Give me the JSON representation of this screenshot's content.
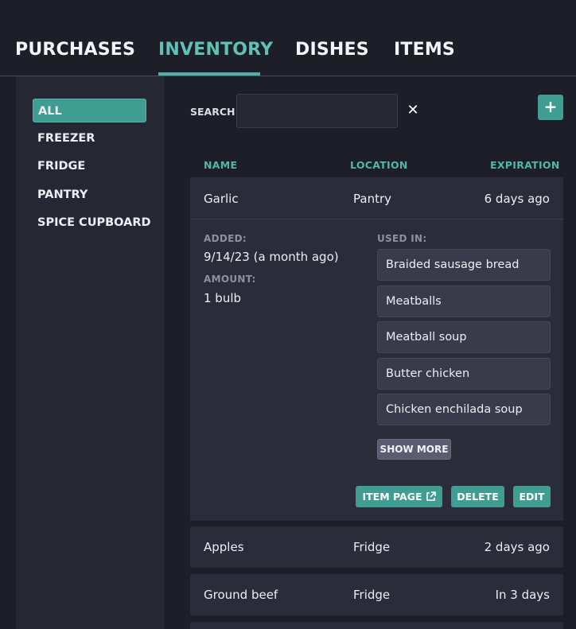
{
  "nav": {
    "tabs": [
      {
        "label": "PURCHASES"
      },
      {
        "label": "INVENTORY"
      },
      {
        "label": "DISHES"
      },
      {
        "label": "ITEMS"
      }
    ],
    "active_tab": "INVENTORY"
  },
  "sidebar": {
    "items": [
      {
        "label": "ALL"
      },
      {
        "label": "FREEZER"
      },
      {
        "label": "FRIDGE"
      },
      {
        "label": "PANTRY"
      },
      {
        "label": "SPICE CUPBOARD"
      }
    ],
    "active": "ALL"
  },
  "search": {
    "label": "SEARCH",
    "value": "",
    "clear_symbol": "✕"
  },
  "add_button": {
    "symbol": "+"
  },
  "table": {
    "headers": {
      "name": "NAME",
      "location": "LOCATION",
      "expiration": "EXPIRATION"
    },
    "expanded_row": {
      "name": "Garlic",
      "location": "Pantry",
      "expiration": "6 days ago",
      "added_label": "ADDED:",
      "added_value": "9/14/23 (a month ago)",
      "amount_label": "AMOUNT:",
      "amount_value": "1 bulb",
      "used_in_label": "USED IN:",
      "used_in": [
        "Braided sausage bread",
        "Meatballs",
        "Meatball soup",
        "Butter chicken",
        "Chicken enchilada soup"
      ],
      "show_more_label": "SHOW MORE",
      "actions": {
        "item_page": "ITEM PAGE",
        "delete": "DELETE",
        "edit": "EDIT"
      }
    },
    "rows": [
      {
        "name": "Apples",
        "location": "Fridge",
        "expiration": "2 days ago"
      },
      {
        "name": "Ground beef",
        "location": "Fridge",
        "expiration": "In 3 days"
      }
    ]
  },
  "colors": {
    "accent": "#3f9d91",
    "accent_text": "#5fc1b3",
    "background": "#1d1e28",
    "panel": "#2a2c39"
  }
}
